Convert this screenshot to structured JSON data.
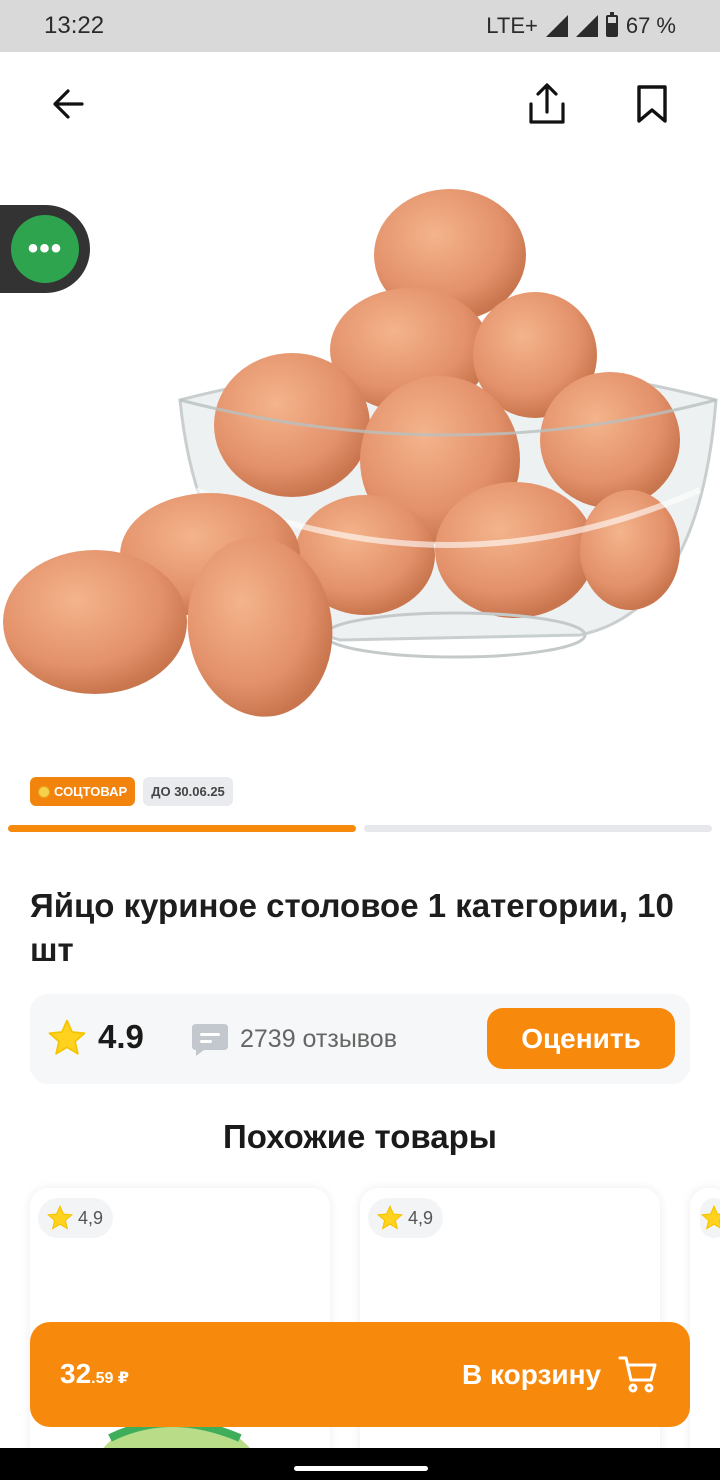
{
  "status_bar": {
    "time": "13:22",
    "network": "LTE+",
    "battery": "67 %"
  },
  "nav": {
    "back_icon": "arrow-left-icon",
    "share_icon": "share-icon",
    "bookmark_icon": "bookmark-icon"
  },
  "floating_menu": {
    "icon": "more-dots-icon",
    "label": "•••",
    "color": "#2ea44f"
  },
  "product": {
    "image": "brown-eggs-in-glass-bowl",
    "badges": {
      "social": "СОЦТОВАР",
      "date": "ДО 30.06.25"
    },
    "gallery": {
      "current": 1,
      "total": 2
    },
    "title": "Яйцо куриное столовое 1 категории, 10 шт",
    "rating": {
      "value": "4.9",
      "reviews": "2739 отзывов",
      "rate_button": "Оценить"
    }
  },
  "similar": {
    "title": "Похожие товары",
    "cards": [
      {
        "rating": "4,9"
      },
      {
        "rating": "4,9"
      },
      {
        "rating": ""
      }
    ]
  },
  "cart": {
    "price_main": "32",
    "price_cents": ".59",
    "currency": "₽",
    "label": "В корзину",
    "icon": "cart-icon"
  },
  "colors": {
    "accent": "#f78a0c",
    "star": "#ffd21f",
    "social_badge": "#f2840e"
  }
}
